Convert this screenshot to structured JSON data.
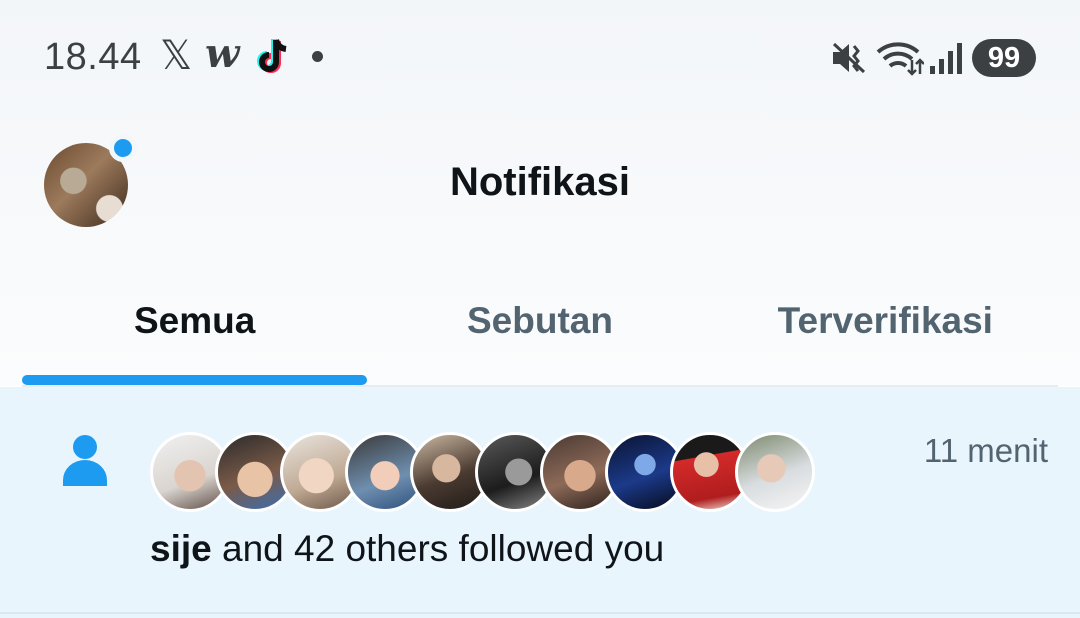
{
  "status_bar": {
    "time": "18.44",
    "icons": [
      "x-app-icon",
      "webtoon-app-icon",
      "tiktok-app-icon",
      "more-notifications-dot",
      "vibrate-mute-icon",
      "wifi-icon",
      "cell-signal-icon"
    ],
    "battery": "99"
  },
  "header": {
    "title": "Notifikasi",
    "x_glyph": "𝕏",
    "w_glyph": "w"
  },
  "tabs": [
    {
      "label": "Semua",
      "active": true
    },
    {
      "label": "Sebutan",
      "active": false
    },
    {
      "label": "Terverifikasi",
      "active": false
    }
  ],
  "notification": {
    "icon": "person-icon",
    "time": "11 menit",
    "user": "sije",
    "text": " and 42 others followed you",
    "avatar_count": 10
  },
  "colors": {
    "accent": "#1d9bf0",
    "notification_bg": "#e9f5fd",
    "text_primary": "#0f1419",
    "text_secondary": "#536471"
  }
}
